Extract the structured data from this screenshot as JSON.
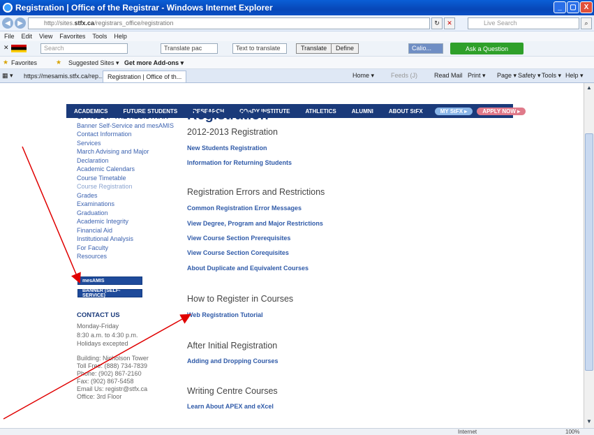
{
  "window": {
    "title": "Registration | Office of the Registrar - Windows Internet Explorer",
    "min": "_",
    "max": "▢",
    "close": "X"
  },
  "address": {
    "url_prefix": "http://sites.",
    "url_domain": "stfx.ca",
    "url_path": "/registrars_office/registration",
    "search_placeholder": "Live Search"
  },
  "menu": [
    "File",
    "Edit",
    "View",
    "Favorites",
    "Tools",
    "Help"
  ],
  "toolbar": {
    "search_placeholder": "Search",
    "translate_select": "Translate pac",
    "translate_input": "Text to translate",
    "translate_btn": "Translate",
    "define_btn": "Define",
    "calc": "Calio...",
    "ask": "Ask a Question"
  },
  "favbar": {
    "favorites": "Favorites",
    "suggested": "Suggested Sites ▾",
    "addons": "Get more Add-ons ▾"
  },
  "tabs": [
    {
      "label": "https://mesamis.stfx.ca/rep..."
    },
    {
      "label": "Registration | Office of th..."
    }
  ],
  "commands": {
    "home": "Home ▾",
    "feeds": "Feeds (J)",
    "readmail": "Read Mail",
    "print": "Print ▾",
    "page": "Page ▾",
    "safety": "Safety ▾",
    "tools": "Tools ▾",
    "help": "Help ▾"
  },
  "sitenav": [
    "ACADEMICS",
    "FUTURE STUDENTS",
    "RESEARCH",
    "COADY INSTITUTE",
    "ATHLETICS",
    "ALUMNI",
    "ABOUT StFX"
  ],
  "sitenav_pills": [
    "MY StFX ▸",
    "APPLY NOW ▸"
  ],
  "sidebar": {
    "heading": "OFFICE OF THE REGISTRAR",
    "links": [
      "Banner Self-Service and mesAMIS",
      "Contact Information",
      "Services",
      "March Advising and Major",
      "Declaration",
      "Academic Calendars",
      "Course Timetable",
      "Course Registration",
      "Grades",
      "Examinations",
      "Graduation",
      "Academic Integrity",
      "Financial Aid",
      "Institutional Analysis",
      "For Faculty",
      "Resources"
    ],
    "btn_mesamis": "mesAMIS",
    "btn_banner": "BANNER (SELF-SERVICE)",
    "contact_heading": "CONTACT US",
    "contact_lines": [
      "Monday-Friday",
      "8:30 a.m. to 4:30 p.m.",
      "Holidays excepted",
      "",
      "Building: Nicholson Tower",
      "Toll Free: (888) 734-7839",
      "Phone: (902) 867-2160",
      "Fax: (902) 867-5458",
      "Email Us: registr@stfx.ca",
      "Office: 3rd Floor"
    ]
  },
  "main": {
    "title": "Registration",
    "s1_heading": "2012-2013 Registration",
    "s1_links": [
      "New Students Registration",
      "Information for Returning Students"
    ],
    "s2_heading": "Registration Errors and Restrictions",
    "s2_links": [
      "Common Registration Error Messages",
      "View Degree, Program and Major Restrictions",
      "View Course Section Prerequisites",
      "View Course Section Corequisites",
      "About Duplicate and Equivalent Courses"
    ],
    "s3_heading": "How to Register in Courses",
    "s3_links": [
      "Web Registration Tutorial"
    ],
    "s4_heading": "After Initial Registration",
    "s4_links": [
      "Adding and Dropping Courses"
    ],
    "s5_heading": "Writing Centre Courses",
    "s5_links": [
      "Learn About APEX and eXcel"
    ]
  },
  "status": {
    "zone": "Internet",
    "zoom": "100%"
  },
  "colors": {
    "annotation_arrow": "#e00000",
    "site_nav": "#1a3a7a",
    "link": "#2f5aa8"
  }
}
